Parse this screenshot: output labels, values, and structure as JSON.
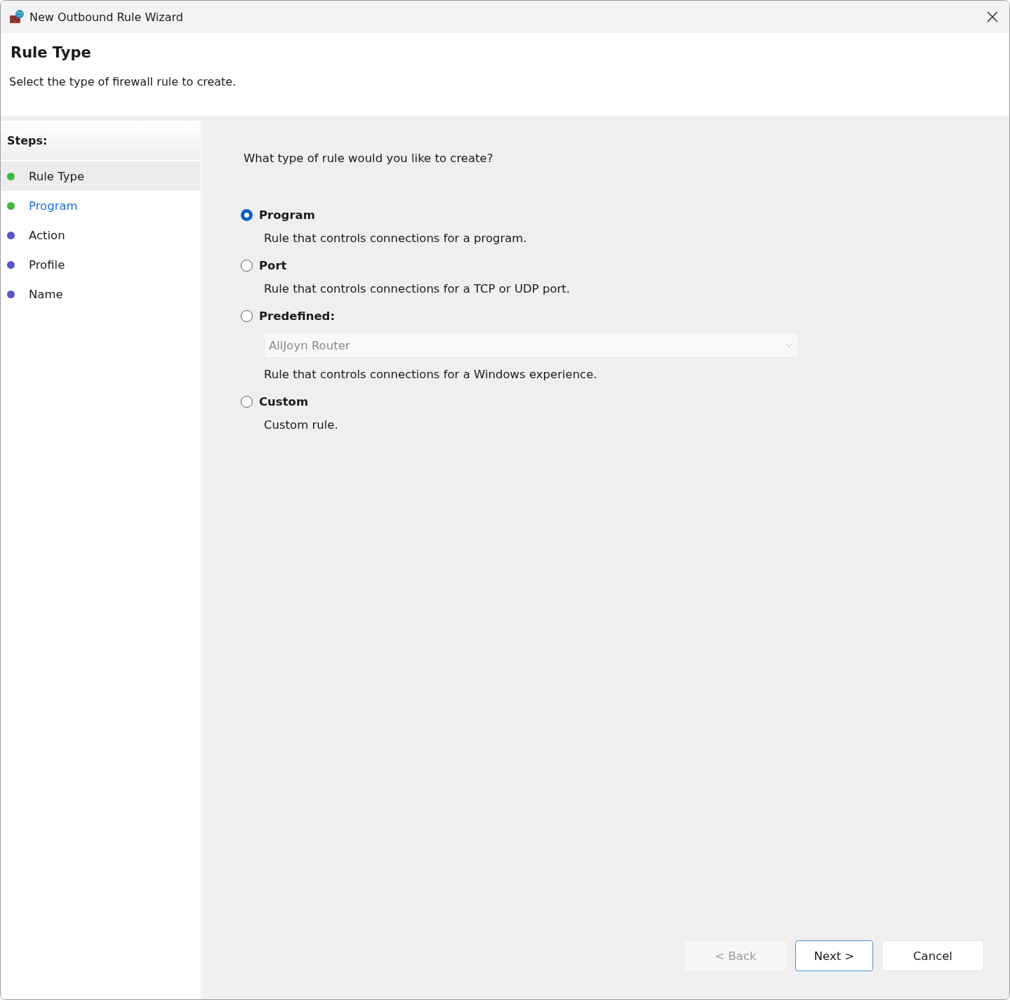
{
  "window": {
    "title": "New Outbound Rule Wizard"
  },
  "header": {
    "title": "Rule Type",
    "subtitle": "Select the type of firewall rule to create."
  },
  "steps": {
    "heading": "Steps:",
    "items": [
      {
        "label": "Rule Type",
        "selected": true,
        "hovered": false,
        "color": "#3cb93c"
      },
      {
        "label": "Program",
        "selected": false,
        "hovered": true,
        "color": "#3cb93c"
      },
      {
        "label": "Action",
        "selected": false,
        "hovered": false,
        "color": "#5a55c8"
      },
      {
        "label": "Profile",
        "selected": false,
        "hovered": false,
        "color": "#5a55c8"
      },
      {
        "label": "Name",
        "selected": false,
        "hovered": false,
        "color": "#5a55c8"
      }
    ]
  },
  "question": "What type of rule would you like to create?",
  "options": [
    {
      "label": "Program",
      "description": "Rule that controls connections for a program.",
      "selected": true
    },
    {
      "label": "Port",
      "description": "Rule that controls connections for a TCP or UDP port.",
      "selected": false
    },
    {
      "label": "Predefined:",
      "description": "Rule that controls connections for a Windows experience.",
      "selected": false,
      "dropdown": {
        "value": "AllJoyn Router",
        "disabled": true
      }
    },
    {
      "label": "Custom",
      "description": "Custom rule.",
      "selected": false
    }
  ],
  "buttons": [
    {
      "label": "< Back",
      "disabled": true,
      "default": false
    },
    {
      "label": "Next >",
      "disabled": false,
      "default": true
    },
    {
      "label": "Cancel",
      "disabled": false,
      "default": false
    }
  ]
}
